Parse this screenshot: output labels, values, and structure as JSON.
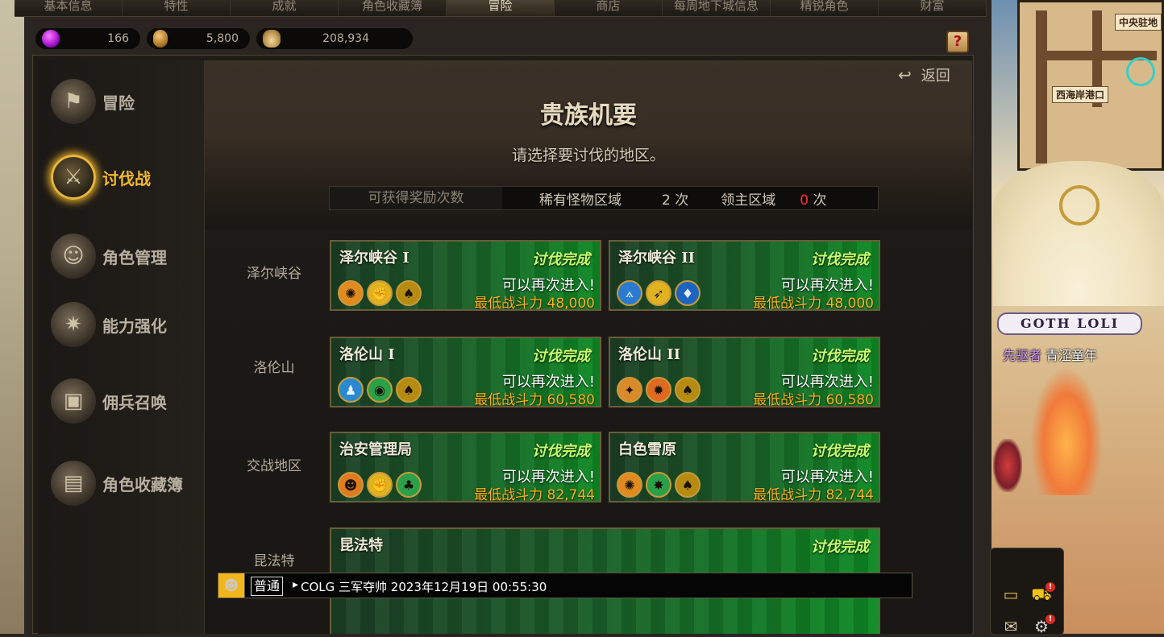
{
  "tabs": [
    "基本信息",
    "特性",
    "成就",
    "角色收藏簿",
    "冒险",
    "商店",
    "每周地下城信息",
    "精锐角色",
    "财富"
  ],
  "active_tab_index": 4,
  "currency": [
    {
      "icon": "purple-gem-icon",
      "value": "166"
    },
    {
      "icon": "gold-coin-icon",
      "value": "5,800"
    },
    {
      "icon": "coin-pile-icon",
      "value": "208,934"
    }
  ],
  "sidebar": {
    "items": [
      {
        "label": "冒险",
        "icon": "flag-icon"
      },
      {
        "label": "讨伐战",
        "icon": "crossed-swords-icon"
      },
      {
        "label": "角色管理",
        "icon": "character-icon"
      },
      {
        "label": "能力强化",
        "icon": "star-burst-icon"
      },
      {
        "label": "佣兵召唤",
        "icon": "chest-icon"
      },
      {
        "label": "角色收藏簿",
        "icon": "book-icon"
      }
    ],
    "active_index": 1
  },
  "header": {
    "back_label": "返回",
    "title": "贵族机要",
    "subtitle": "请选择要讨伐的地区。"
  },
  "reward_bar": {
    "label": "可获得奖励次数",
    "rare_label": "稀有怪物区域",
    "rare_count": "2 次",
    "lord_label": "领主区域",
    "lord_count": "0",
    "lord_unit": "次"
  },
  "regions": [
    {
      "name": "泽尔峡谷",
      "cards": [
        {
          "name": "泽尔峡谷 I",
          "status": "讨伐完成",
          "again": "可以再次进入!",
          "power": "最低战斗力 48,000",
          "icons": [
            "orange",
            "gold",
            "gold"
          ]
        },
        {
          "name": "泽尔峡谷 II",
          "status": "讨伐完成",
          "again": "可以再次进入!",
          "power": "最低战斗力 48,000",
          "icons": [
            "blue",
            "gold",
            "blue"
          ]
        }
      ]
    },
    {
      "name": "洛伦山",
      "cards": [
        {
          "name": "洛伦山 I",
          "status": "讨伐完成",
          "again": "可以再次进入!",
          "power": "最低战斗力 60,580",
          "icons": [
            "blue",
            "green",
            "gold"
          ]
        },
        {
          "name": "洛伦山 II",
          "status": "讨伐完成",
          "again": "可以再次进入!",
          "power": "最低战斗力 60,580",
          "icons": [
            "orange",
            "orange",
            "gold"
          ]
        }
      ]
    },
    {
      "name": "交战地区",
      "cards": [
        {
          "name": "治安管理局",
          "status": "讨伐完成",
          "again": "可以再次进入!",
          "power": "最低战斗力 82,744",
          "icons": [
            "orange",
            "gold",
            "green"
          ]
        },
        {
          "name": "白色雪原",
          "status": "讨伐完成",
          "again": "可以再次进入!",
          "power": "最低战斗力 82,744",
          "icons": [
            "orange",
            "green",
            "gold"
          ]
        }
      ]
    },
    {
      "name": "昆法特",
      "cards": [
        {
          "name": "昆法特",
          "status": "讨伐完成"
        }
      ]
    }
  ],
  "chat": {
    "channel": "普通",
    "message": "COLG 三军夺帅 2023年12月19日 00:55:30"
  },
  "overlay": {
    "minimap_labels": [
      "中央驻地",
      "西海岸港口"
    ],
    "character_tag": "GOTH LOLI",
    "character_title": "先驱者",
    "character_name": "青涩童年"
  },
  "colors": {
    "accent_gold": "#f3b92c",
    "card_green": "#0f8a24",
    "status_green": "#c7ff6e",
    "power_orange": "#ffb21a",
    "alert_red": "#ff2d2d"
  }
}
